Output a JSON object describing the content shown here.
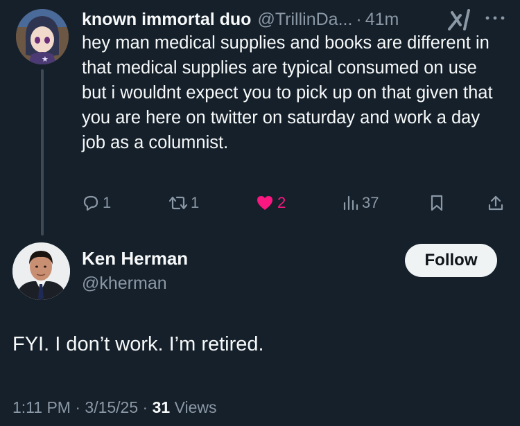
{
  "parent_tweet": {
    "display_name": "known immortal duo",
    "handle": "@TrillinDa...",
    "separator": "·",
    "time": "41m",
    "text": "hey man medical supplies and books are different in that medical supplies are typical consumed on use but i wouldnt expect you to pick up on that given that you are here on twitter on saturday and work a day job as a columnist.",
    "actions": {
      "replies": "1",
      "retweets": "1",
      "likes": "2",
      "views": "37"
    },
    "icons": [
      "reply-icon",
      "retweet-icon",
      "heart-icon",
      "views-icon",
      "bookmark-icon",
      "share-icon",
      "grok-icon",
      "more-icon"
    ]
  },
  "main_tweet": {
    "display_name": "Ken Herman",
    "handle": "@kherman",
    "follow_label": "Follow",
    "text": "FYI. I don’t work. I’m retired.",
    "time": "1:11 PM",
    "sep1": "·",
    "date": "3/15/25",
    "sep2": "·",
    "views_count": "31",
    "views_label": "Views"
  },
  "colors": {
    "background": "#15202b",
    "text": "#f7f9f9",
    "secondary": "#8b98a5",
    "like": "#f91880",
    "thread_line": "#3c4a58"
  }
}
